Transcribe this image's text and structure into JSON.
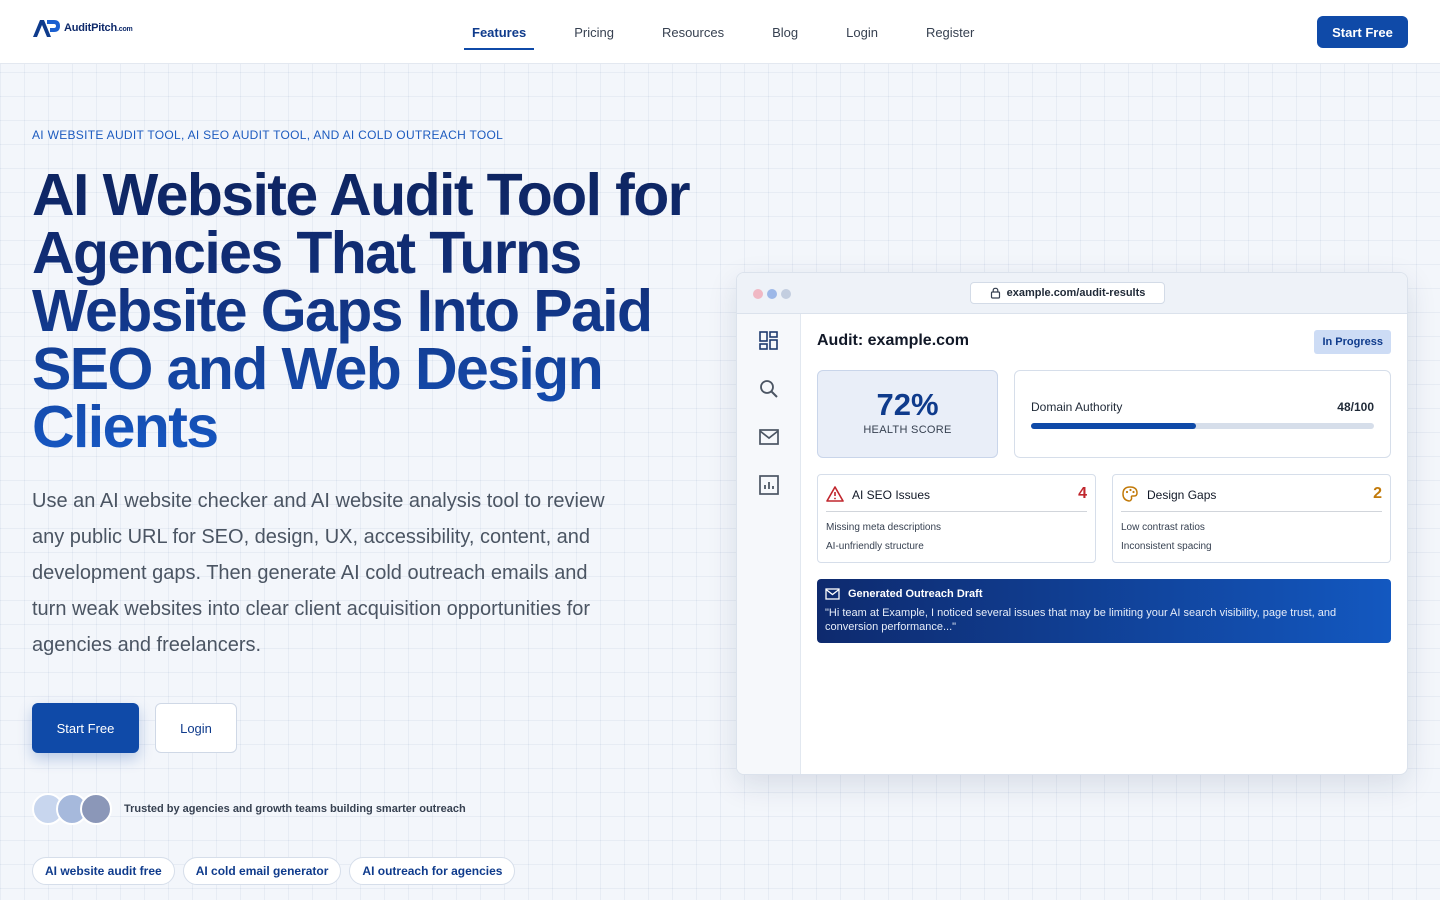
{
  "header": {
    "logo_text": "AuditPitch",
    "logo_suffix": ".com",
    "nav": [
      {
        "label": "Features"
      },
      {
        "label": "Pricing"
      },
      {
        "label": "Resources"
      },
      {
        "label": "Blog"
      },
      {
        "label": "Login"
      },
      {
        "label": "Register"
      }
    ],
    "active_nav": "Features",
    "cta_label": "Start Free"
  },
  "hero": {
    "eyebrow": "AI WEBSITE AUDIT TOOL, AI SEO AUDIT TOOL, AND AI COLD OUTREACH TOOL",
    "title": "AI Website Audit Tool for Agencies That Turns Website Gaps Into Paid SEO and Web Design Clients",
    "description": "Use an AI website checker and AI website analysis tool to review any public URL for SEO, design, UX, accessibility, content, and development gaps. Then generate AI cold outreach emails and turn weak websites into clear client acquisition opportunities for agencies and freelancers.",
    "primary_button": "Start Free",
    "secondary_button": "Login",
    "trust_text": "Trusted by agencies and growth teams building smarter outreach",
    "chips": [
      "AI website audit free",
      "AI cold email generator",
      "AI outreach for agencies"
    ]
  },
  "preview": {
    "url": "example.com/audit-results",
    "audit_title": "Audit: example.com",
    "status_badge": "In Progress",
    "health_score": "72%",
    "health_label": "HEALTH SCORE",
    "domain_authority_label": "Domain Authority",
    "domain_authority_value": "48/100",
    "domain_authority_fraction": 0.48,
    "seo_issues": {
      "title": "AI SEO Issues",
      "count": "4",
      "items": [
        "Missing meta descriptions",
        "AI-unfriendly structure"
      ]
    },
    "design_gaps": {
      "title": "Design Gaps",
      "count": "2",
      "items": [
        "Low contrast ratios",
        "Inconsistent spacing"
      ]
    },
    "outreach": {
      "title": "Generated Outreach Draft",
      "body": "\"Hi team at Example, I noticed several issues that may be limiting your AI search visibility, page trust, and conversion performance...\""
    },
    "sidebar_icons": [
      "dashboard-icon",
      "search-icon",
      "mail-icon",
      "chart-icon"
    ]
  },
  "colors": {
    "primary": "#0f4aa8",
    "navy": "#0e2460",
    "danger": "#c0262d",
    "warning": "#c27a0a",
    "badge_bg": "#cddcf5"
  }
}
